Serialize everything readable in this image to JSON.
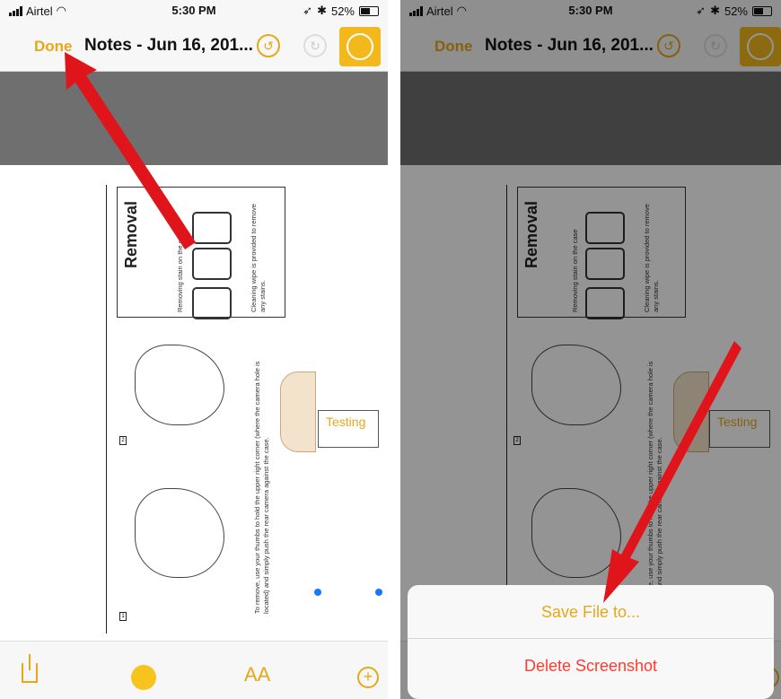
{
  "status": {
    "carrier": "Airtel",
    "time": "5:30 PM",
    "battery": "52%"
  },
  "nav": {
    "done_label": "Done",
    "title": "Notes - Jun 16, 201..."
  },
  "document": {
    "heading": "Removal",
    "box_caption": "Removing stain on the case",
    "box_note": "Cleaning wipe is provided to remove any stains.",
    "instructions": "To remove, use your thumbs to hold the upper right corner (where the camera hole is located) and simply push the rear camera against the case.",
    "step1": "1",
    "step2": "2"
  },
  "annotation": {
    "text": "Testing"
  },
  "toolbar": {
    "font_label": "AA"
  },
  "action_sheet": {
    "save_label": "Save File to...",
    "delete_label": "Delete Screenshot"
  },
  "colors": {
    "accent": "#e6a817",
    "markup_bg": "#f2b81c",
    "destructive": "#ff3b30",
    "arrow": "#e0151b"
  }
}
